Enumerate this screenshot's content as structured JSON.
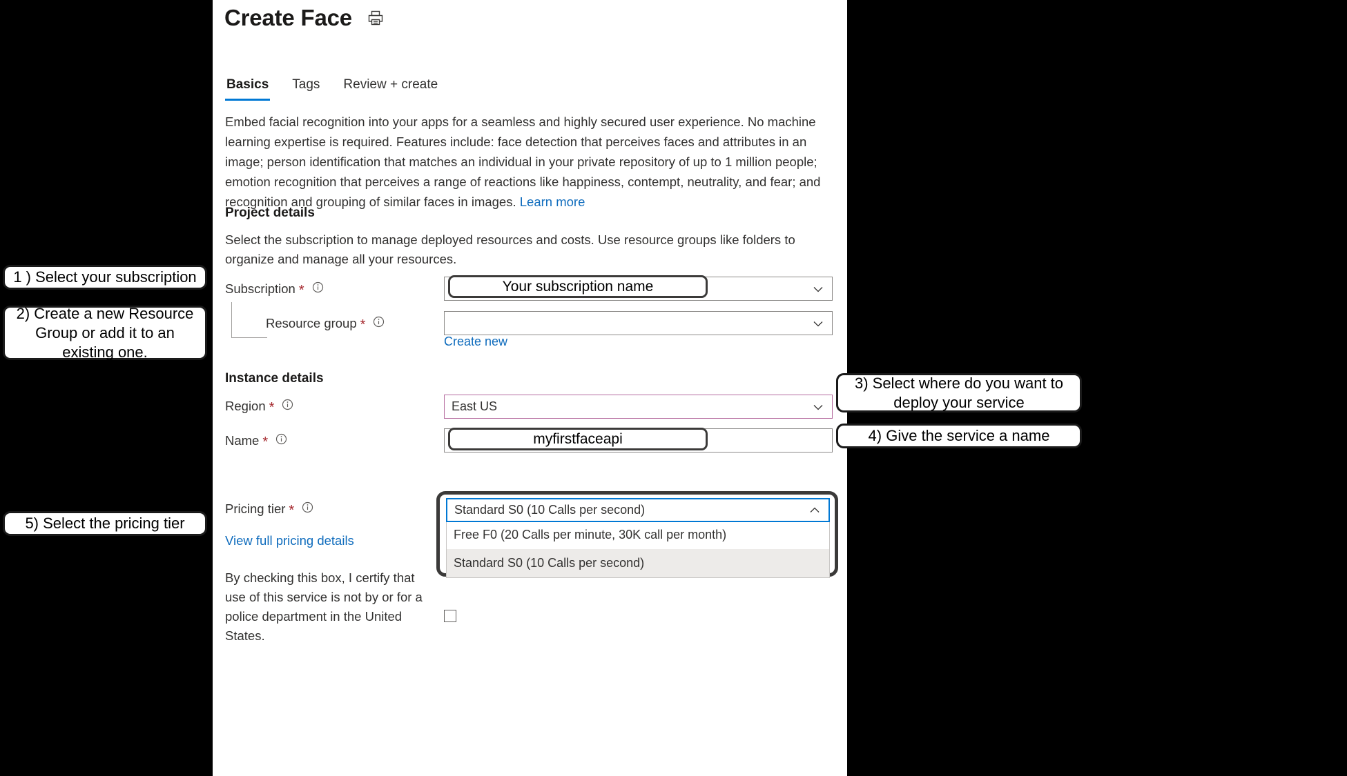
{
  "header": {
    "title": "Create Face",
    "print_icon": "print-icon"
  },
  "tabs": [
    {
      "label": "Basics",
      "active": true
    },
    {
      "label": "Tags",
      "active": false
    },
    {
      "label": "Review + create",
      "active": false
    }
  ],
  "description": {
    "text": "Embed facial recognition into your apps for a seamless and highly secured user experience. No machine learning expertise is required. Features include: face detection that perceives faces and attributes in an image; person identification that matches an individual in your private repository of up to 1 million people; emotion recognition that perceives a range of reactions like happiness, contempt, neutrality, and fear; and recognition and grouping of similar faces in images. ",
    "link": "Learn more"
  },
  "project_details": {
    "heading": "Project details",
    "subtext": "Select the subscription to manage deployed resources and costs. Use resource groups like folders to organize and manage all your resources.",
    "subscription": {
      "label": "Subscription",
      "required": "*",
      "value": "Your subscription name"
    },
    "resource_group": {
      "label": "Resource group",
      "required": "*",
      "value": "",
      "create_new": "Create new"
    }
  },
  "instance_details": {
    "heading": "Instance details",
    "region": {
      "label": "Region",
      "required": "*",
      "value": "East US"
    },
    "name": {
      "label": "Name",
      "required": "*",
      "value": "myfirstfaceapi"
    },
    "pricing_tier": {
      "label": "Pricing tier",
      "required": "*",
      "value": "Standard S0 (10 Calls per second)",
      "options": [
        {
          "label": "Free F0 (20 Calls per minute, 30K call per month)",
          "selected": false
        },
        {
          "label": "Standard S0 (10 Calls per second)",
          "selected": true
        }
      ],
      "pricing_link": "View full pricing details"
    }
  },
  "consent": {
    "text": "By checking this box, I certify that use of this service is not by or for a police department in the United States."
  },
  "callouts": [
    {
      "id": 1,
      "text": "1 ) Select your subscription"
    },
    {
      "id": 2,
      "text": "2) Create a new Resource Group or add it to an existing one."
    },
    {
      "id": 3,
      "text": "3) Select where do you want to deploy your service"
    },
    {
      "id": 4,
      "text": "4) Give the service a name"
    },
    {
      "id": 5,
      "text": "5) Select the pricing tier"
    }
  ],
  "colors": {
    "accent": "#0078d4",
    "link": "#0f6cbd",
    "required": "#a4262c",
    "region_border": "#b4689d",
    "background": "#000000"
  }
}
